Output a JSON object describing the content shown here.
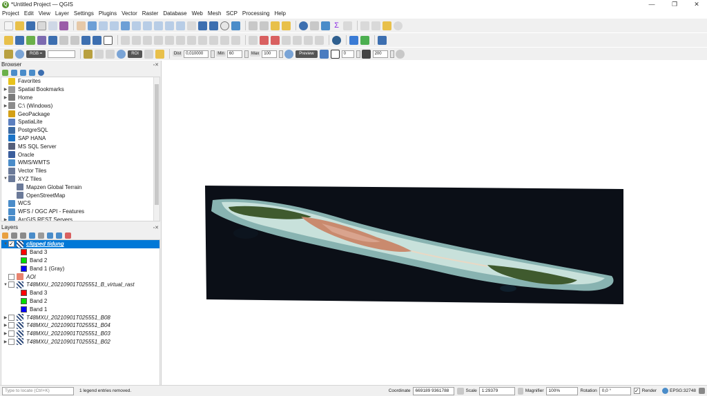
{
  "window": {
    "title": "*Untitled Project — QGIS",
    "logo": "Q",
    "minimize": "—",
    "maximize": "❐",
    "close": "✕"
  },
  "menu": [
    "Project",
    "Edit",
    "View",
    "Layer",
    "Settings",
    "Plugins",
    "Vector",
    "Raster",
    "Database",
    "Web",
    "Mesh",
    "SCP",
    "Processing",
    "Help"
  ],
  "scp_toolbar": {
    "rgb_label": "RGB =",
    "roi_label": "ROI",
    "dist_label": "Dist",
    "dist_value": "0,010000",
    "min_label": "Min",
    "min_value": "60",
    "max_label": "Max",
    "max_value": "100",
    "preview_label": "Preview",
    "value_a": "0",
    "value_b": "200"
  },
  "browser": {
    "title": "Browser",
    "items": [
      {
        "label": "Favorites",
        "icon": "star-icon",
        "color": "#e8c21c",
        "arrow": ""
      },
      {
        "label": "Spatial Bookmarks",
        "icon": "bookmark-icon",
        "color": "#9a9a9a",
        "arrow": "▶"
      },
      {
        "label": "Home",
        "icon": "home-icon",
        "color": "#7a7a7a",
        "arrow": "▶"
      },
      {
        "label": "C:\\ (Windows)",
        "icon": "drive-icon",
        "color": "#8c8c8c",
        "arrow": "▶"
      },
      {
        "label": "GeoPackage",
        "icon": "geopackage-icon",
        "color": "#d4a017",
        "arrow": ""
      },
      {
        "label": "SpatiaLite",
        "icon": "spatialite-icon",
        "color": "#5b7fbf",
        "arrow": ""
      },
      {
        "label": "PostgreSQL",
        "icon": "postgresql-icon",
        "color": "#3b6aa3",
        "arrow": ""
      },
      {
        "label": "SAP HANA",
        "icon": "sap-hana-icon",
        "color": "#1a73c7",
        "arrow": ""
      },
      {
        "label": "MS SQL Server",
        "icon": "mssql-icon",
        "color": "#555f7a",
        "arrow": ""
      },
      {
        "label": "Oracle",
        "icon": "oracle-icon",
        "color": "#3a5d9c",
        "arrow": ""
      },
      {
        "label": "WMS/WMTS",
        "icon": "wms-icon",
        "color": "#4a8cc9",
        "arrow": ""
      },
      {
        "label": "Vector Tiles",
        "icon": "vector-tiles-icon",
        "color": "#6b7a99",
        "arrow": ""
      },
      {
        "label": "XYZ Tiles",
        "icon": "xyz-tiles-icon",
        "color": "#6b7a99",
        "arrow": "▼"
      },
      {
        "label": "Mapzen Global Terrain",
        "icon": "tile-layer-icon",
        "color": "#6b7a99",
        "arrow": "",
        "indent": true
      },
      {
        "label": "OpenStreetMap",
        "icon": "tile-layer-icon",
        "color": "#6b7a99",
        "arrow": "",
        "indent": true
      },
      {
        "label": "WCS",
        "icon": "wcs-icon",
        "color": "#4a8cc9",
        "arrow": ""
      },
      {
        "label": "WFS / OGC API - Features",
        "icon": "wfs-icon",
        "color": "#4a8cc9",
        "arrow": ""
      },
      {
        "label": "ArcGIS REST Servers",
        "icon": "arcgis-icon",
        "color": "#4a8cc9",
        "arrow": "▶"
      }
    ]
  },
  "layers": {
    "title": "Layers",
    "items": [
      {
        "kind": "raster",
        "label": "clipped tidung",
        "checked": true,
        "selected": true,
        "arrow": "▼",
        "style": "bold-it"
      },
      {
        "kind": "band",
        "label": "Band 3",
        "color": "#ff0000"
      },
      {
        "kind": "band",
        "label": "Band 2",
        "color": "#00dd00"
      },
      {
        "kind": "band",
        "label": "Band 1 (Gray)",
        "color": "#0000ff"
      },
      {
        "kind": "vector",
        "label": "AOI",
        "checked": false,
        "arrow": "",
        "color": "#e8836f",
        "style": "it"
      },
      {
        "kind": "raster",
        "label": "T48MXU_20210901T025551_B_virtual_rast",
        "checked": false,
        "arrow": "▼",
        "style": "it"
      },
      {
        "kind": "band",
        "label": "Band 3",
        "color": "#ff0000"
      },
      {
        "kind": "band",
        "label": "Band 2",
        "color": "#00dd00"
      },
      {
        "kind": "band",
        "label": "Band 1",
        "color": "#0000ff"
      },
      {
        "kind": "raster",
        "label": "T48MXU_20210901T025551_B08",
        "checked": false,
        "arrow": "▶",
        "style": "it"
      },
      {
        "kind": "raster",
        "label": "T48MXU_20210901T025551_B04",
        "checked": false,
        "arrow": "▶",
        "style": "it"
      },
      {
        "kind": "raster",
        "label": "T48MXU_20210901T025551_B03",
        "checked": false,
        "arrow": "▶",
        "style": "it"
      },
      {
        "kind": "raster",
        "label": "T48MXU_20210901T025551_B02",
        "checked": false,
        "arrow": "▶",
        "style": "it"
      }
    ]
  },
  "status": {
    "locator_placeholder": "Type to locate (Ctrl+K)",
    "message": "1 legend entries removed.",
    "coordinate_label": "Coordinate",
    "coordinate_value": "669189  9361788",
    "scale_label": "Scale",
    "scale_value": "1:29379",
    "magnifier_label": "Magnifier",
    "magnifier_value": "100%",
    "rotation_label": "Rotation",
    "rotation_value": "0,0 °",
    "render_label": "Render",
    "crs_label": "EPSG:32748"
  }
}
